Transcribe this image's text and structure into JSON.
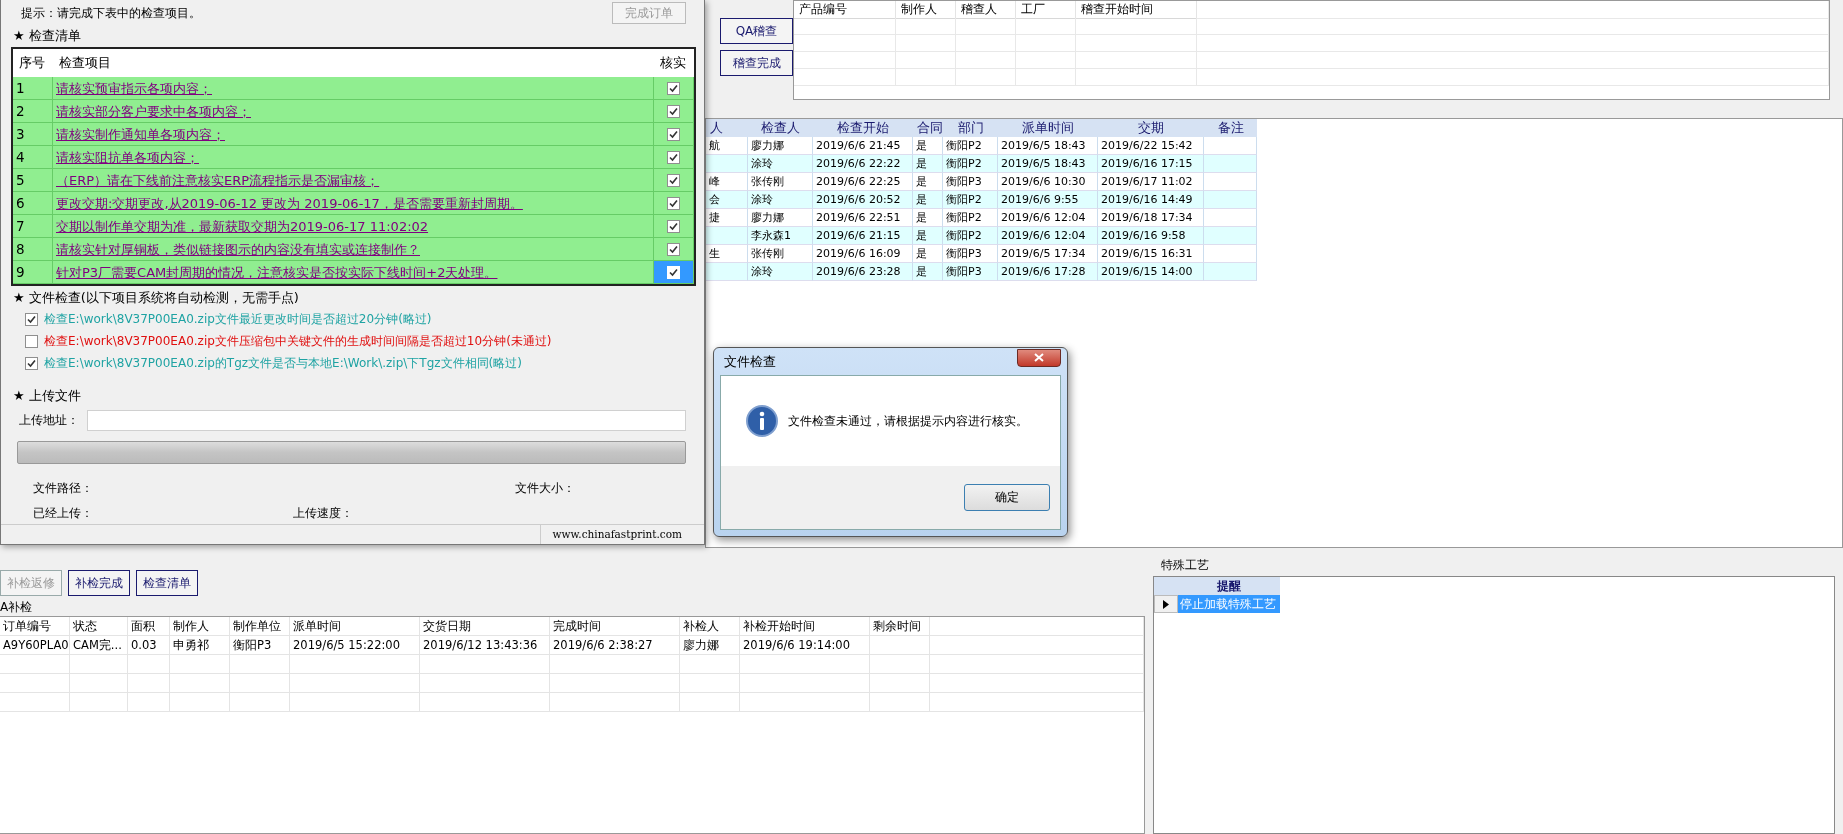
{
  "checklist_dialog": {
    "hint": "提示：请完成下表中的检查项目。",
    "finish_button": {
      "label": "完成订单",
      "disabled": true
    },
    "checklist": {
      "title": "★ 检查清单",
      "columns": [
        "序号",
        "检查项目",
        "核实"
      ],
      "rows": [
        {
          "no": "1",
          "item": "请核实预审指示各项内容；",
          "checked": true,
          "selected": false
        },
        {
          "no": "2",
          "item": "请核实部分客户要求中各项内容；",
          "checked": true,
          "selected": false
        },
        {
          "no": "3",
          "item": "请核实制作通知单各项内容；",
          "checked": true,
          "selected": false
        },
        {
          "no": "4",
          "item": "请核实阻抗单各项内容；",
          "checked": true,
          "selected": false
        },
        {
          "no": "5",
          "item": "（ERP）请在下线前注意核实ERP流程指示是否漏审核；",
          "checked": true,
          "selected": false
        },
        {
          "no": "6",
          "item": "更改交期:交期更改,从2019-06-12 更改为 2019-06-17，是否需要重新封周期。",
          "checked": true,
          "selected": false
        },
        {
          "no": "7",
          "item": "交期以制作单交期为准，最新获取交期为2019-06-17 11:02:02",
          "checked": true,
          "selected": false
        },
        {
          "no": "8",
          "item": "请核实针对厚铜板，类似链接图示的内容没有填实或连接制作？",
          "checked": true,
          "selected": false
        },
        {
          "no": "9",
          "item": "针对P3厂需要CAM封周期的情况，注意核实是否按实际下线时间+2天处理。",
          "checked": true,
          "selected": true
        }
      ]
    },
    "file_check": {
      "title": "★ 文件检查(以下项目系统将自动检测，无需手点)",
      "items": [
        {
          "text": "检查E:\\work\\8V37P00EA0.zip文件最近更改时间是否超过20分钟(略过)",
          "checked": true,
          "passed": true
        },
        {
          "text": "检查E:\\work\\8V37P00EA0.zip文件压缩包中关键文件的生成时间间隔是否超过10分钟(未通过)",
          "checked": false,
          "passed": false
        },
        {
          "text": "检查E:\\work\\8V37P00EA0.zip的Tgz文件是否与本地E:\\Work\\.zip\\下Tgz文件相同(略过)",
          "checked": true,
          "passed": true
        }
      ]
    },
    "upload": {
      "title": "★ 上传文件",
      "address_label": "上传地址：",
      "file_path_label": "文件路径：",
      "file_size_label": "文件大小：",
      "uploaded_label": "已经上传：",
      "speed_label": "上传速度："
    },
    "status_bar": "www.chinafastprint.com"
  },
  "audit": {
    "buttons": [
      "QA稽查",
      "稽查完成"
    ],
    "columns": [
      "产品编号",
      "制作人",
      "稽查人",
      "工厂",
      "稽查开始时间"
    ]
  },
  "inspection_table": {
    "columns": [
      "人",
      "检查人",
      "检查开始",
      "合同",
      "部门",
      "派单时间",
      "交期",
      "备注"
    ],
    "rows": [
      {
        "column_1": "航",
        "inspector": "廖力娜",
        "start": "2019/6/6 21:45",
        "contract": "是",
        "department": "衡阳P2",
        "dispatch_time": "2019/6/5 18:43",
        "due": "2019/6/22 15:42"
      },
      {
        "inspector": "涂玲",
        "start": "2019/6/6 22:22",
        "contract": "是",
        "department": "衡阳P2",
        "dispatch_time": "2019/6/5 18:43",
        "due": "2019/6/16 17:15"
      },
      {
        "column_1": "峰",
        "inspector": "张传刚",
        "start": "2019/6/6 22:25",
        "contract": "是",
        "department": "衡阳P3",
        "dispatch_time": "2019/6/6 10:30",
        "due": "2019/6/17 11:02"
      },
      {
        "column_1": "会",
        "inspector": "涂玲",
        "start": "2019/6/6 20:52",
        "contract": "是",
        "department": "衡阳P2",
        "dispatch_time": "2019/6/6 9:55",
        "due": "2019/6/16 14:49"
      },
      {
        "column_1": "捷",
        "inspector": "廖力娜",
        "start": "2019/6/6 22:51",
        "contract": "是",
        "department": "衡阳P2",
        "dispatch_time": "2019/6/6 12:04",
        "due": "2019/6/18 17:34"
      },
      {
        "inspector": "李永森1",
        "start": "2019/6/6 21:15",
        "contract": "是",
        "department": "衡阳P2",
        "dispatch_time": "2019/6/6 12:04",
        "due": "2019/6/16 9:58"
      },
      {
        "column_1": "生",
        "inspector": "张传刚",
        "start": "2019/6/6 16:09",
        "contract": "是",
        "department": "衡阳P3",
        "dispatch_time": "2019/6/5 17:34",
        "due": "2019/6/15 16:31"
      },
      {
        "inspector": "涂玲",
        "start": "2019/6/6 23:28",
        "contract": "是",
        "department": "衡阳P3",
        "dispatch_time": "2019/6/6 17:28",
        "due": "2019/6/15 14:00"
      }
    ]
  },
  "recheck": {
    "buttons": [
      {
        "label": "补检返修",
        "disabled": true
      },
      {
        "label": "补检完成",
        "disabled": false
      },
      {
        "label": "检查清单",
        "disabled": false
      }
    ],
    "title": "A补检",
    "columns": [
      "订单编号",
      "状态",
      "面积",
      "制作人",
      "制作单位",
      "派单时间",
      "交货日期",
      "完成时间",
      "补检人",
      "补检开始时间",
      "剩余时间"
    ],
    "rows": [
      [
        "A9Y60PLA0",
        "CAM完...",
        "0.03",
        "申勇祁",
        "衡阳P3",
        "2019/6/5 15:22:00",
        "2019/6/12 13:43:36",
        "2019/6/6 2:38:27",
        "廖力娜",
        "2019/6/6 19:14:00"
      ]
    ]
  },
  "special_process": {
    "title": "特殊工艺",
    "column": "提醒",
    "rows": [
      {
        "text": "停止加载特殊工艺",
        "selected": true
      }
    ]
  },
  "message_box": {
    "title": "文件检查",
    "message": "文件检查未通过，请根据提示内容进行核实。",
    "ok_button": "确定"
  }
}
